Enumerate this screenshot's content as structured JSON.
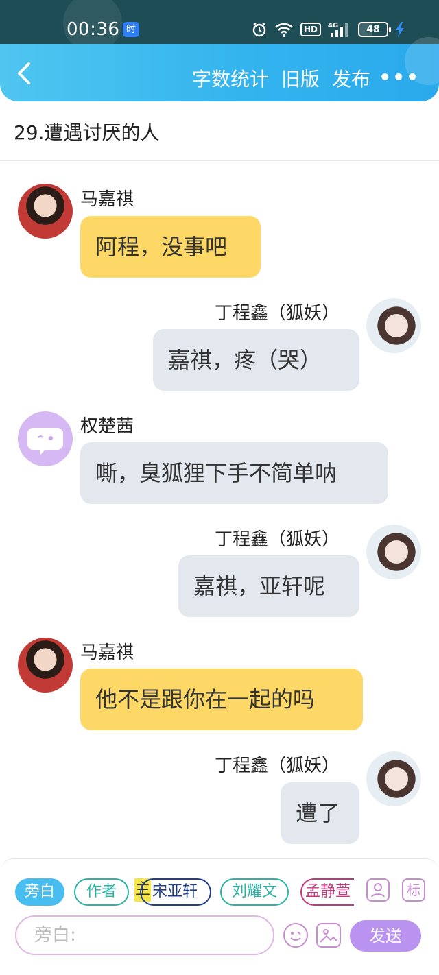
{
  "status_bar": {
    "time": "00:36",
    "app_badge": "时",
    "hd": "HD",
    "network": "4G",
    "battery": "48"
  },
  "header": {
    "actions": [
      "字数统计",
      "旧版",
      "发布"
    ],
    "more": "•••"
  },
  "chapter_title": "29.遭遇讨厌的人",
  "messages": [
    {
      "speaker": "马嘉祺",
      "text": "阿程，没事吧",
      "side": "left",
      "avatar": "avatar-ma-jiaqi",
      "bubble_color": "#fdd866"
    },
    {
      "speaker": "丁程鑫（狐妖）",
      "text": "嘉祺，疼（哭）",
      "side": "right",
      "avatar": "avatar-ding-chengxin",
      "bubble_color": "#e3e8ef"
    },
    {
      "speaker": "权楚茜",
      "text": "嘶，臭狐狸下手不简单呐",
      "side": "left",
      "avatar": "chat-bubble-avatar-icon",
      "bubble_color": "#e3e8ef"
    },
    {
      "speaker": "丁程鑫（狐妖）",
      "text": "嘉祺，亚轩呢",
      "side": "right",
      "avatar": "avatar-ding-chengxin",
      "bubble_color": "#e3e8ef"
    },
    {
      "speaker": "马嘉祺",
      "text": "他不是跟你在一起的吗",
      "side": "left",
      "avatar": "avatar-ma-jiaqi",
      "bubble_color": "#fdd866"
    },
    {
      "speaker": "丁程鑫（狐妖）",
      "text": "遭了",
      "side": "right",
      "avatar": "avatar-ding-chengxin",
      "bubble_color": "#e3e8ef"
    }
  ],
  "composer": {
    "roles": [
      {
        "label": "旁白",
        "selected": true,
        "color": "#48bdf0"
      },
      {
        "label": "作者",
        "selected": false,
        "color": "#2bb3a8"
      },
      {
        "label": "宋亚轩",
        "selected": false,
        "color": "#1e3f8a",
        "badge": "主"
      },
      {
        "label": "刘耀文",
        "selected": false,
        "color": "#2bb3a8"
      },
      {
        "label": "孟静萱",
        "selected": false,
        "color": "#c2367a"
      }
    ],
    "tools": [
      "avatar-select-icon",
      "标"
    ],
    "placeholder": "旁白:",
    "send_label": "发送"
  }
}
